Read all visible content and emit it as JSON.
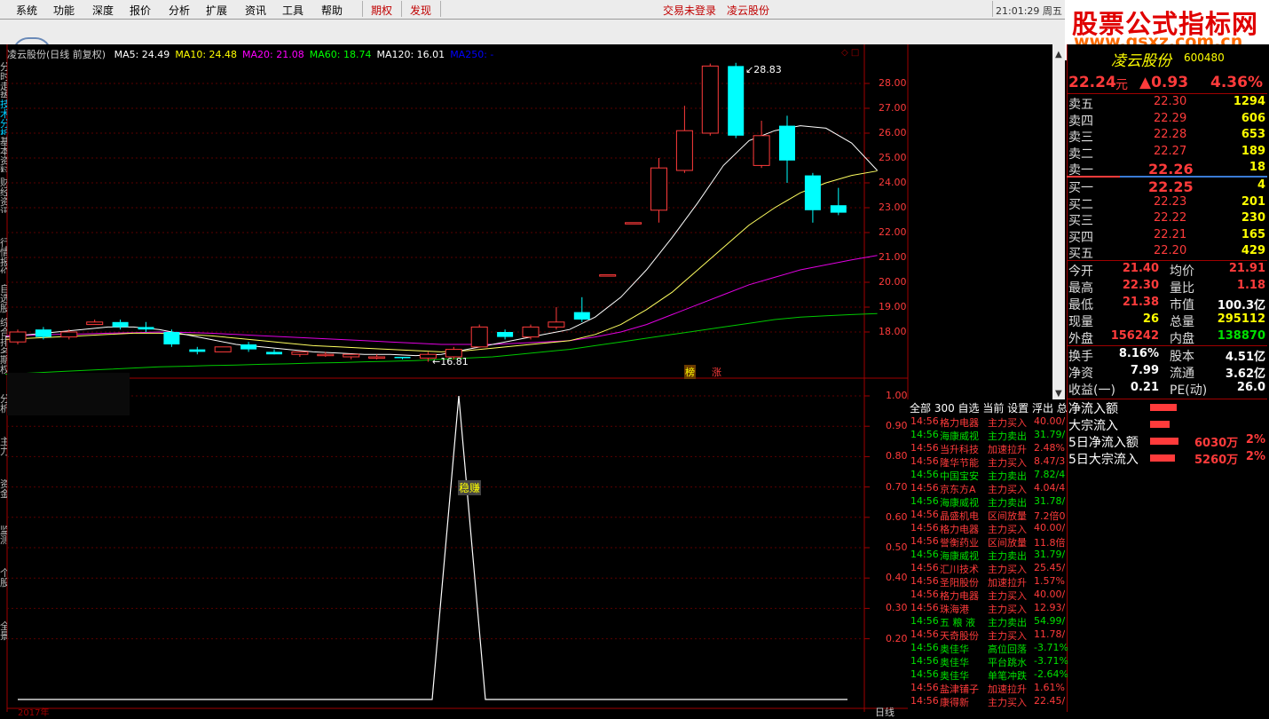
{
  "menu": {
    "items": [
      "系统",
      "功能",
      "深度",
      "报价",
      "分析",
      "扩展",
      "资讯",
      "工具",
      "帮助"
    ],
    "qiquan": "期权",
    "faxian": "发现",
    "trade_status": "交易未登录",
    "stock_name": "凌云股份",
    "time": "21:01:29 周五"
  },
  "logo": {
    "line1": "股票公式指标网",
    "line2": "www.gsxz.com.cn"
  },
  "sidebar_tabs": [
    "分时走势",
    "技术分析",
    "基本资料",
    "财经资讯",
    "行情报价",
    "自选股",
    "综合排名",
    "期权",
    "分析",
    "主力",
    "资金",
    "监测",
    "个股",
    "全景"
  ],
  "chart": {
    "title": "凌云股份(日线 前复权)",
    "ma": [
      {
        "label": "MA5: 24.49",
        "color": "#ffffff"
      },
      {
        "label": "MA10: 24.48",
        "color": "#ffff00"
      },
      {
        "label": "MA20: 21.08",
        "color": "#ff00ff"
      },
      {
        "label": "MA60: 18.74",
        "color": "#00ff00"
      },
      {
        "label": "MA120: 16.01",
        "color": "#ffffff"
      },
      {
        "label": "MA250: -",
        "color": "#0000ff"
      }
    ],
    "price_axis": [
      "28.00",
      "27.00",
      "26.00",
      "25.00",
      "24.00",
      "23.00",
      "22.00",
      "21.00",
      "20.00",
      "19.00",
      "18.00"
    ],
    "high_label": "28.83",
    "low_label": "16.81",
    "markers": [
      "榜",
      "涨"
    ],
    "indicator_axis": [
      "1.00",
      "0.90",
      "0.80",
      "0.70",
      "0.60",
      "0.50",
      "0.40",
      "0.30",
      "0.20"
    ],
    "signal_label": "稳赚",
    "date_label": "2017年",
    "period_label": "日线"
  },
  "chart_data": {
    "type": "candlestick",
    "title": "凌云股份(日线 前复权)",
    "ylim": [
      17.5,
      28.9
    ],
    "candles": [
      {
        "o": 17.6,
        "c": 18.0,
        "h": 18.1,
        "l": 17.5
      },
      {
        "o": 18.1,
        "c": 17.8,
        "h": 18.2,
        "l": 17.7
      },
      {
        "o": 17.8,
        "c": 18.0,
        "h": 18.1,
        "l": 17.7
      },
      {
        "o": 18.3,
        "c": 18.4,
        "h": 18.5,
        "l": 18.3
      },
      {
        "o": 18.4,
        "c": 18.2,
        "h": 18.5,
        "l": 18.1
      },
      {
        "o": 18.2,
        "c": 18.1,
        "h": 18.4,
        "l": 18.0
      },
      {
        "o": 18.0,
        "c": 17.5,
        "h": 18.1,
        "l": 17.4
      },
      {
        "o": 17.3,
        "c": 17.2,
        "h": 17.4,
        "l": 17.1
      },
      {
        "o": 17.2,
        "c": 17.4,
        "h": 17.4,
        "l": 17.2
      },
      {
        "o": 17.5,
        "c": 17.3,
        "h": 17.6,
        "l": 17.2
      },
      {
        "o": 17.2,
        "c": 17.1,
        "h": 17.3,
        "l": 17.1
      },
      {
        "o": 17.1,
        "c": 17.2,
        "h": 17.2,
        "l": 17.0
      },
      {
        "o": 17.1,
        "c": 17.1,
        "h": 17.2,
        "l": 17.0
      },
      {
        "o": 17.0,
        "c": 17.1,
        "h": 17.1,
        "l": 16.9
      },
      {
        "o": 17.0,
        "c": 17.0,
        "h": 17.1,
        "l": 16.9
      },
      {
        "o": 17.0,
        "c": 16.95,
        "h": 17.0,
        "l": 16.9
      },
      {
        "o": 16.95,
        "c": 17.1,
        "h": 17.2,
        "l": 16.8
      },
      {
        "o": 17.0,
        "c": 17.3,
        "h": 17.4,
        "l": 16.9
      },
      {
        "o": 17.4,
        "c": 18.2,
        "h": 18.3,
        "l": 17.4
      },
      {
        "o": 18.0,
        "c": 17.8,
        "h": 18.1,
        "l": 17.7
      },
      {
        "o": 17.8,
        "c": 18.2,
        "h": 18.3,
        "l": 17.7
      },
      {
        "o": 18.2,
        "c": 18.4,
        "h": 19.0,
        "l": 18.1
      },
      {
        "o": 18.8,
        "c": 18.5,
        "h": 19.4,
        "l": 18.4
      },
      {
        "o": 20.3,
        "c": 20.3,
        "h": 20.3,
        "l": 20.3
      },
      {
        "o": 22.4,
        "c": 22.4,
        "h": 22.4,
        "l": 22.4
      },
      {
        "o": 22.9,
        "c": 24.6,
        "h": 25.0,
        "l": 22.4
      },
      {
        "o": 24.5,
        "c": 26.1,
        "h": 27.1,
        "l": 24.4
      },
      {
        "o": 26.0,
        "c": 28.7,
        "h": 28.8,
        "l": 25.9
      },
      {
        "o": 28.7,
        "c": 25.9,
        "h": 28.83,
        "l": 25.8
      },
      {
        "o": 24.7,
        "c": 25.9,
        "h": 26.5,
        "l": 24.6
      },
      {
        "o": 26.3,
        "c": 24.9,
        "h": 26.7,
        "l": 24.0
      },
      {
        "o": 24.3,
        "c": 22.9,
        "h": 24.4,
        "l": 22.4
      },
      {
        "o": 23.1,
        "c": 22.8,
        "h": 23.8,
        "l": 22.7
      }
    ],
    "ma5": [
      17.8,
      17.9,
      18.0,
      18.1,
      18.2,
      18.2,
      18.1,
      17.9,
      17.7,
      17.5,
      17.4,
      17.3,
      17.2,
      17.15,
      17.1,
      17.1,
      17.05,
      17.1,
      17.3,
      17.5,
      17.7,
      17.9,
      18.1,
      18.6,
      19.4,
      20.5,
      21.8,
      23.2,
      24.7,
      25.7,
      26.1,
      26.3,
      26.2,
      25.6,
      24.5
    ],
    "ma10": [
      17.7,
      17.75,
      17.8,
      17.85,
      17.9,
      17.95,
      17.95,
      17.9,
      17.85,
      17.75,
      17.65,
      17.55,
      17.45,
      17.4,
      17.35,
      17.3,
      17.25,
      17.2,
      17.25,
      17.35,
      17.45,
      17.55,
      17.65,
      17.9,
      18.3,
      18.9,
      19.6,
      20.5,
      21.4,
      22.3,
      23.0,
      23.6,
      24.0,
      24.3,
      24.48
    ],
    "ma20": [
      17.85,
      17.87,
      17.9,
      17.92,
      17.95,
      17.97,
      18.0,
      17.98,
      17.95,
      17.9,
      17.85,
      17.8,
      17.75,
      17.7,
      17.65,
      17.6,
      17.55,
      17.5,
      17.5,
      17.5,
      17.55,
      17.6,
      17.65,
      17.8,
      18.0,
      18.3,
      18.7,
      19.1,
      19.5,
      19.9,
      20.2,
      20.5,
      20.7,
      20.9,
      21.08
    ],
    "ma60": [
      16.3,
      16.35,
      16.4,
      16.45,
      16.5,
      16.55,
      16.6,
      16.62,
      16.65,
      16.67,
      16.7,
      16.72,
      16.75,
      16.77,
      16.8,
      16.82,
      16.85,
      16.9,
      16.95,
      17.0,
      17.1,
      17.2,
      17.3,
      17.45,
      17.6,
      17.75,
      17.9,
      18.05,
      18.2,
      18.35,
      18.5,
      18.6,
      18.65,
      18.7,
      18.74
    ],
    "indicator": {
      "baseline": 0,
      "peak": 1.0,
      "peak_index": 17
    }
  },
  "quote": {
    "name": "凌云股份",
    "code": "600480",
    "price": "22.24",
    "unit": "元",
    "change": "▲0.93",
    "pct": "4.36%",
    "asks": [
      {
        "label": "卖五",
        "price": "22.30",
        "vol": "1294"
      },
      {
        "label": "卖四",
        "price": "22.29",
        "vol": "606"
      },
      {
        "label": "卖三",
        "price": "22.28",
        "vol": "653"
      },
      {
        "label": "卖二",
        "price": "22.27",
        "vol": "189"
      },
      {
        "label": "卖一",
        "price": "22.26",
        "vol": "18"
      }
    ],
    "bids": [
      {
        "label": "买一",
        "price": "22.25",
        "vol": "4"
      },
      {
        "label": "买二",
        "price": "22.23",
        "vol": "201"
      },
      {
        "label": "买三",
        "price": "22.22",
        "vol": "230"
      },
      {
        "label": "买四",
        "price": "22.21",
        "vol": "165"
      },
      {
        "label": "买五",
        "price": "22.20",
        "vol": "429"
      }
    ],
    "stats": [
      {
        "l1": "今开",
        "v1": "21.40",
        "l2": "均价",
        "v2": "21.91",
        "c1": "#ff3b3b",
        "c2": "#ff3b3b"
      },
      {
        "l1": "最高",
        "v1": "22.30",
        "l2": "量比",
        "v2": "1.18",
        "c1": "#ff3b3b",
        "c2": "#ff3b3b"
      },
      {
        "l1": "最低",
        "v1": "21.38",
        "l2": "市值",
        "v2": "100.3亿",
        "c1": "#ff3b3b",
        "c2": "#ffffff"
      },
      {
        "l1": "现量",
        "v1": "26",
        "l2": "总量",
        "v2": "295112",
        "c1": "#ffff00",
        "c2": "#ffff00"
      },
      {
        "l1": "外盘",
        "v1": "156242",
        "l2": "内盘",
        "v2": "138870",
        "c1": "#ff3b3b",
        "c2": "#00e000"
      }
    ],
    "stats2": [
      {
        "l1": "换手",
        "v1": "8.16%",
        "l2": "股本",
        "v2": "4.51亿"
      },
      {
        "l1": "净资",
        "v1": "7.99",
        "l2": "流通",
        "v2": "3.62亿"
      },
      {
        "l1": "收益(一)",
        "v1": "0.21",
        "l2": "PE(动)",
        "v2": "26.0"
      }
    ]
  },
  "news_tabs": "全部 300 自选 当前 设置 浮出 总",
  "news": [
    {
      "t": "14:56",
      "n": "格力电器",
      "a": "主力买入",
      "v": "40.00/",
      "c": "#ff3b3b"
    },
    {
      "t": "14:56",
      "n": "海康威视",
      "a": "主力卖出",
      "v": "31.79/",
      "c": "#00e000"
    },
    {
      "t": "14:56",
      "n": "当升科技",
      "a": "加速拉升",
      "v": "2.48%",
      "c": "#ff3b3b"
    },
    {
      "t": "14:56",
      "n": "隆华节能",
      "a": "主力买入",
      "v": "8.47/3",
      "c": "#ff3b3b"
    },
    {
      "t": "14:56",
      "n": "中国宝安",
      "a": "主力卖出",
      "v": "7.82/4",
      "c": "#00e000"
    },
    {
      "t": "14:56",
      "n": "京东方A",
      "a": "主力买入",
      "v": "4.04/4",
      "c": "#ff3b3b"
    },
    {
      "t": "14:56",
      "n": "海康威视",
      "a": "主力卖出",
      "v": "31.78/",
      "c": "#00e000"
    },
    {
      "t": "14:56",
      "n": "晶盛机电",
      "a": "区间放量",
      "v": "7.2倍0",
      "c": "#ff3b3b"
    },
    {
      "t": "14:56",
      "n": "格力电器",
      "a": "主力买入",
      "v": "40.00/",
      "c": "#ff3b3b"
    },
    {
      "t": "14:56",
      "n": "誉衡药业",
      "a": "区间放量",
      "v": "11.8倍",
      "c": "#ff3b3b"
    },
    {
      "t": "14:56",
      "n": "海康威视",
      "a": "主力卖出",
      "v": "31.79/",
      "c": "#00e000"
    },
    {
      "t": "14:56",
      "n": "汇川技术",
      "a": "主力买入",
      "v": "25.45/",
      "c": "#ff3b3b"
    },
    {
      "t": "14:56",
      "n": "圣阳股份",
      "a": "加速拉升",
      "v": "1.57%",
      "c": "#ff3b3b"
    },
    {
      "t": "14:56",
      "n": "格力电器",
      "a": "主力买入",
      "v": "40.00/",
      "c": "#ff3b3b"
    },
    {
      "t": "14:56",
      "n": "珠海港",
      "a": "主力买入",
      "v": "12.93/",
      "c": "#ff3b3b"
    },
    {
      "t": "14:56",
      "n": "五 粮 液",
      "a": "主力卖出",
      "v": "54.99/",
      "c": "#00e000"
    },
    {
      "t": "14:56",
      "n": "天奇股份",
      "a": "主力买入",
      "v": "11.78/",
      "c": "#ff3b3b"
    },
    {
      "t": "14:56",
      "n": "奥佳华",
      "a": "高位回落",
      "v": "-3.71%",
      "c": "#00e000"
    },
    {
      "t": "14:56",
      "n": "奥佳华",
      "a": "平台跳水",
      "v": "-3.71%",
      "c": "#00e000"
    },
    {
      "t": "14:56",
      "n": "奥佳华",
      "a": "单笔冲跌",
      "v": "-2.64%",
      "c": "#00e000"
    },
    {
      "t": "14:56",
      "n": "盐津铺子",
      "a": "加速拉升",
      "v": "1.61%",
      "c": "#ff3b3b"
    },
    {
      "t": "14:56",
      "n": "康得新",
      "a": "主力买入",
      "v": "22.45/",
      "c": "#ff3b3b"
    }
  ],
  "flow": [
    {
      "label": "净流入额",
      "bar": 30,
      "val": "",
      "pct": ""
    },
    {
      "label": "大宗流入",
      "bar": 22,
      "val": "",
      "pct": ""
    },
    {
      "label": "5日净流入额",
      "bar": 32,
      "val": "6030万",
      "pct": "2%"
    },
    {
      "label": "5日大宗流入",
      "bar": 28,
      "val": "5260万",
      "pct": "2%"
    }
  ]
}
